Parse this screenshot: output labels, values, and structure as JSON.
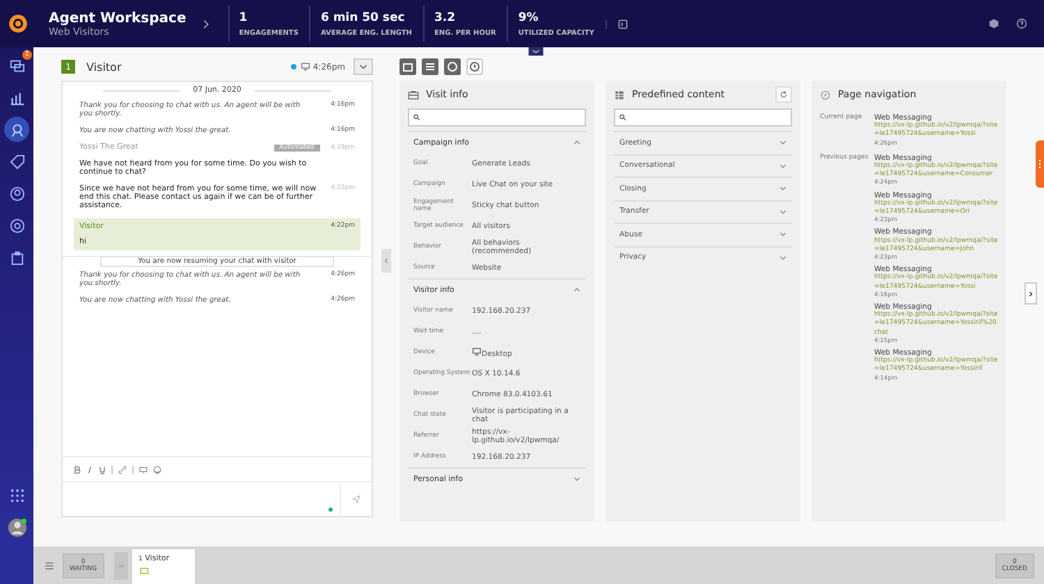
{
  "header": {
    "title": "Agent Workspace",
    "subtitle": "Web Visitors",
    "stats": [
      {
        "value": "1",
        "label": "ENGAGEMENTS"
      },
      {
        "value": "6 min 50 sec",
        "label": "AVERAGE ENG. LENGTH"
      },
      {
        "value": "3.2",
        "label": "ENG. PER HOUR"
      },
      {
        "value": "9%",
        "label": "UTILIZED CAPACITY"
      }
    ]
  },
  "sidebar": {
    "badge": "1",
    "items": [
      {
        "kind": "chat",
        "selected": false
      },
      {
        "kind": "chart",
        "selected": false
      },
      {
        "kind": "agent",
        "selected": true
      },
      {
        "kind": "tag",
        "selected": false
      },
      {
        "kind": "user",
        "selected": false
      },
      {
        "kind": "circle",
        "selected": false
      },
      {
        "kind": "clipboard",
        "selected": false
      }
    ]
  },
  "chat": {
    "number": "1",
    "name": "Visitor",
    "time": "4:26pm",
    "date": "07 Jun. 2020",
    "messages": [
      {
        "kind": "system",
        "text": "Thank you for choosing to chat with us. An agent will be with you shortly.",
        "time": "4:16pm"
      },
      {
        "kind": "system",
        "text": "You are now chatting with Yossi the great.",
        "time": "4:16pm"
      },
      {
        "kind": "author",
        "text": "Yossi The Great",
        "tag": "Automated",
        "time": "4:19pm"
      },
      {
        "kind": "agent",
        "text": "We have not heard from you for some time. Do you wish to continue to chat?"
      },
      {
        "kind": "agent",
        "text": "Since we have not heard from you for some time, we will now end this chat. Please contact us again if we can be of further assistance.",
        "time": "4:22pm"
      },
      {
        "kind": "visitor",
        "author": "Visitor",
        "text": "hi",
        "time": "4:22pm"
      },
      {
        "kind": "notice",
        "text": "You are now resuming your chat with visitor"
      },
      {
        "kind": "system",
        "text": "Thank you for choosing to chat with us. An agent will be with you shortly.",
        "time": "4:26pm"
      },
      {
        "kind": "system",
        "text": "You are now chatting with Yossi the great.",
        "time": "4:26pm"
      }
    ]
  },
  "visit_info": {
    "title": "Visit info",
    "sections": [
      {
        "title": "Campaign info",
        "expanded": true,
        "rows": [
          {
            "label": "Goal",
            "value": "Generate Leads"
          },
          {
            "label": "Campaign",
            "value": "Live Chat on your site"
          },
          {
            "label": "Engagement name",
            "value": "Sticky chat button"
          },
          {
            "label": "Target audience",
            "value": "All visitors"
          },
          {
            "label": "Behavior",
            "value": "All behaviors (recommended)"
          },
          {
            "label": "Source",
            "value": "Website"
          }
        ]
      },
      {
        "title": "Visitor info",
        "expanded": true,
        "rows": [
          {
            "label": "Visitor name",
            "value": "192.168.20.237"
          },
          {
            "label": "Wait time",
            "value": "...."
          },
          {
            "label": "Device",
            "value": "Desktop",
            "kind": "device"
          },
          {
            "label": "Operating System",
            "value": "OS X 10.14.6"
          },
          {
            "label": "Browser",
            "value": "Chrome 83.0.4103.61"
          },
          {
            "label": "Chat state",
            "value": "Visitor is participating in a chat"
          },
          {
            "label": "Referrer",
            "value": "https://vx-lp.github.io/v2/lpwmqa/"
          },
          {
            "label": "IP Address",
            "value": "192.168.20.237"
          }
        ]
      },
      {
        "title": "Personal info",
        "expanded": false
      }
    ]
  },
  "predefined": {
    "title": "Predefined content",
    "categories": [
      "Greeting",
      "Conversational",
      "Closing",
      "Transfer",
      "Abuse",
      "Privacy"
    ]
  },
  "page_navigation": {
    "title": "Page navigation",
    "groups": [
      {
        "label": "Current page",
        "pages": [
          {
            "title": "Web Messaging",
            "url": "https://vx-lp.github.io/v2/lpwmqa/?site=le17495724&username=Yossi",
            "time": "4:26pm"
          }
        ]
      },
      {
        "label": "Previous pages",
        "pages": [
          {
            "title": "Web Messaging",
            "url": "https://vx-lp.github.io/v2/lpwmqa/?site=le17495724&username=Consumer",
            "time": "4:24pm"
          },
          {
            "title": "Web Messaging",
            "url": "https://vx-lp.github.io/v2/lpwmqa/?site=le17495724&username=Ori",
            "time": "4:23pm"
          },
          {
            "title": "Web Messaging",
            "url": "https://vx-lp.github.io/v2/lpwmqa/?site=le17495724&username=John",
            "time": "4:23pm"
          },
          {
            "title": "Web Messaging",
            "url": "https://vx-lp.github.io/v2/lpwmqa/?site=le17495724&username=Yossi",
            "time": "4:16pm"
          },
          {
            "title": "Web Messaging",
            "url": "https://vx-lp.github.io/v2/lpwmqa/?site=le17495724&username=Yossirif%20chat",
            "time": "4:15pm"
          },
          {
            "title": "Web Messaging",
            "url": "https://vx-lp.github.io/v2/lpwmqa/?site=le17495724&username=Yossirif",
            "time": "4:14pm"
          }
        ]
      }
    ]
  },
  "bottom": {
    "waiting_count": "0",
    "waiting_label": "WAITING",
    "tab_number": "1",
    "tab_name": "Visitor",
    "closed_count": "0",
    "closed_label": "CLOSED"
  }
}
